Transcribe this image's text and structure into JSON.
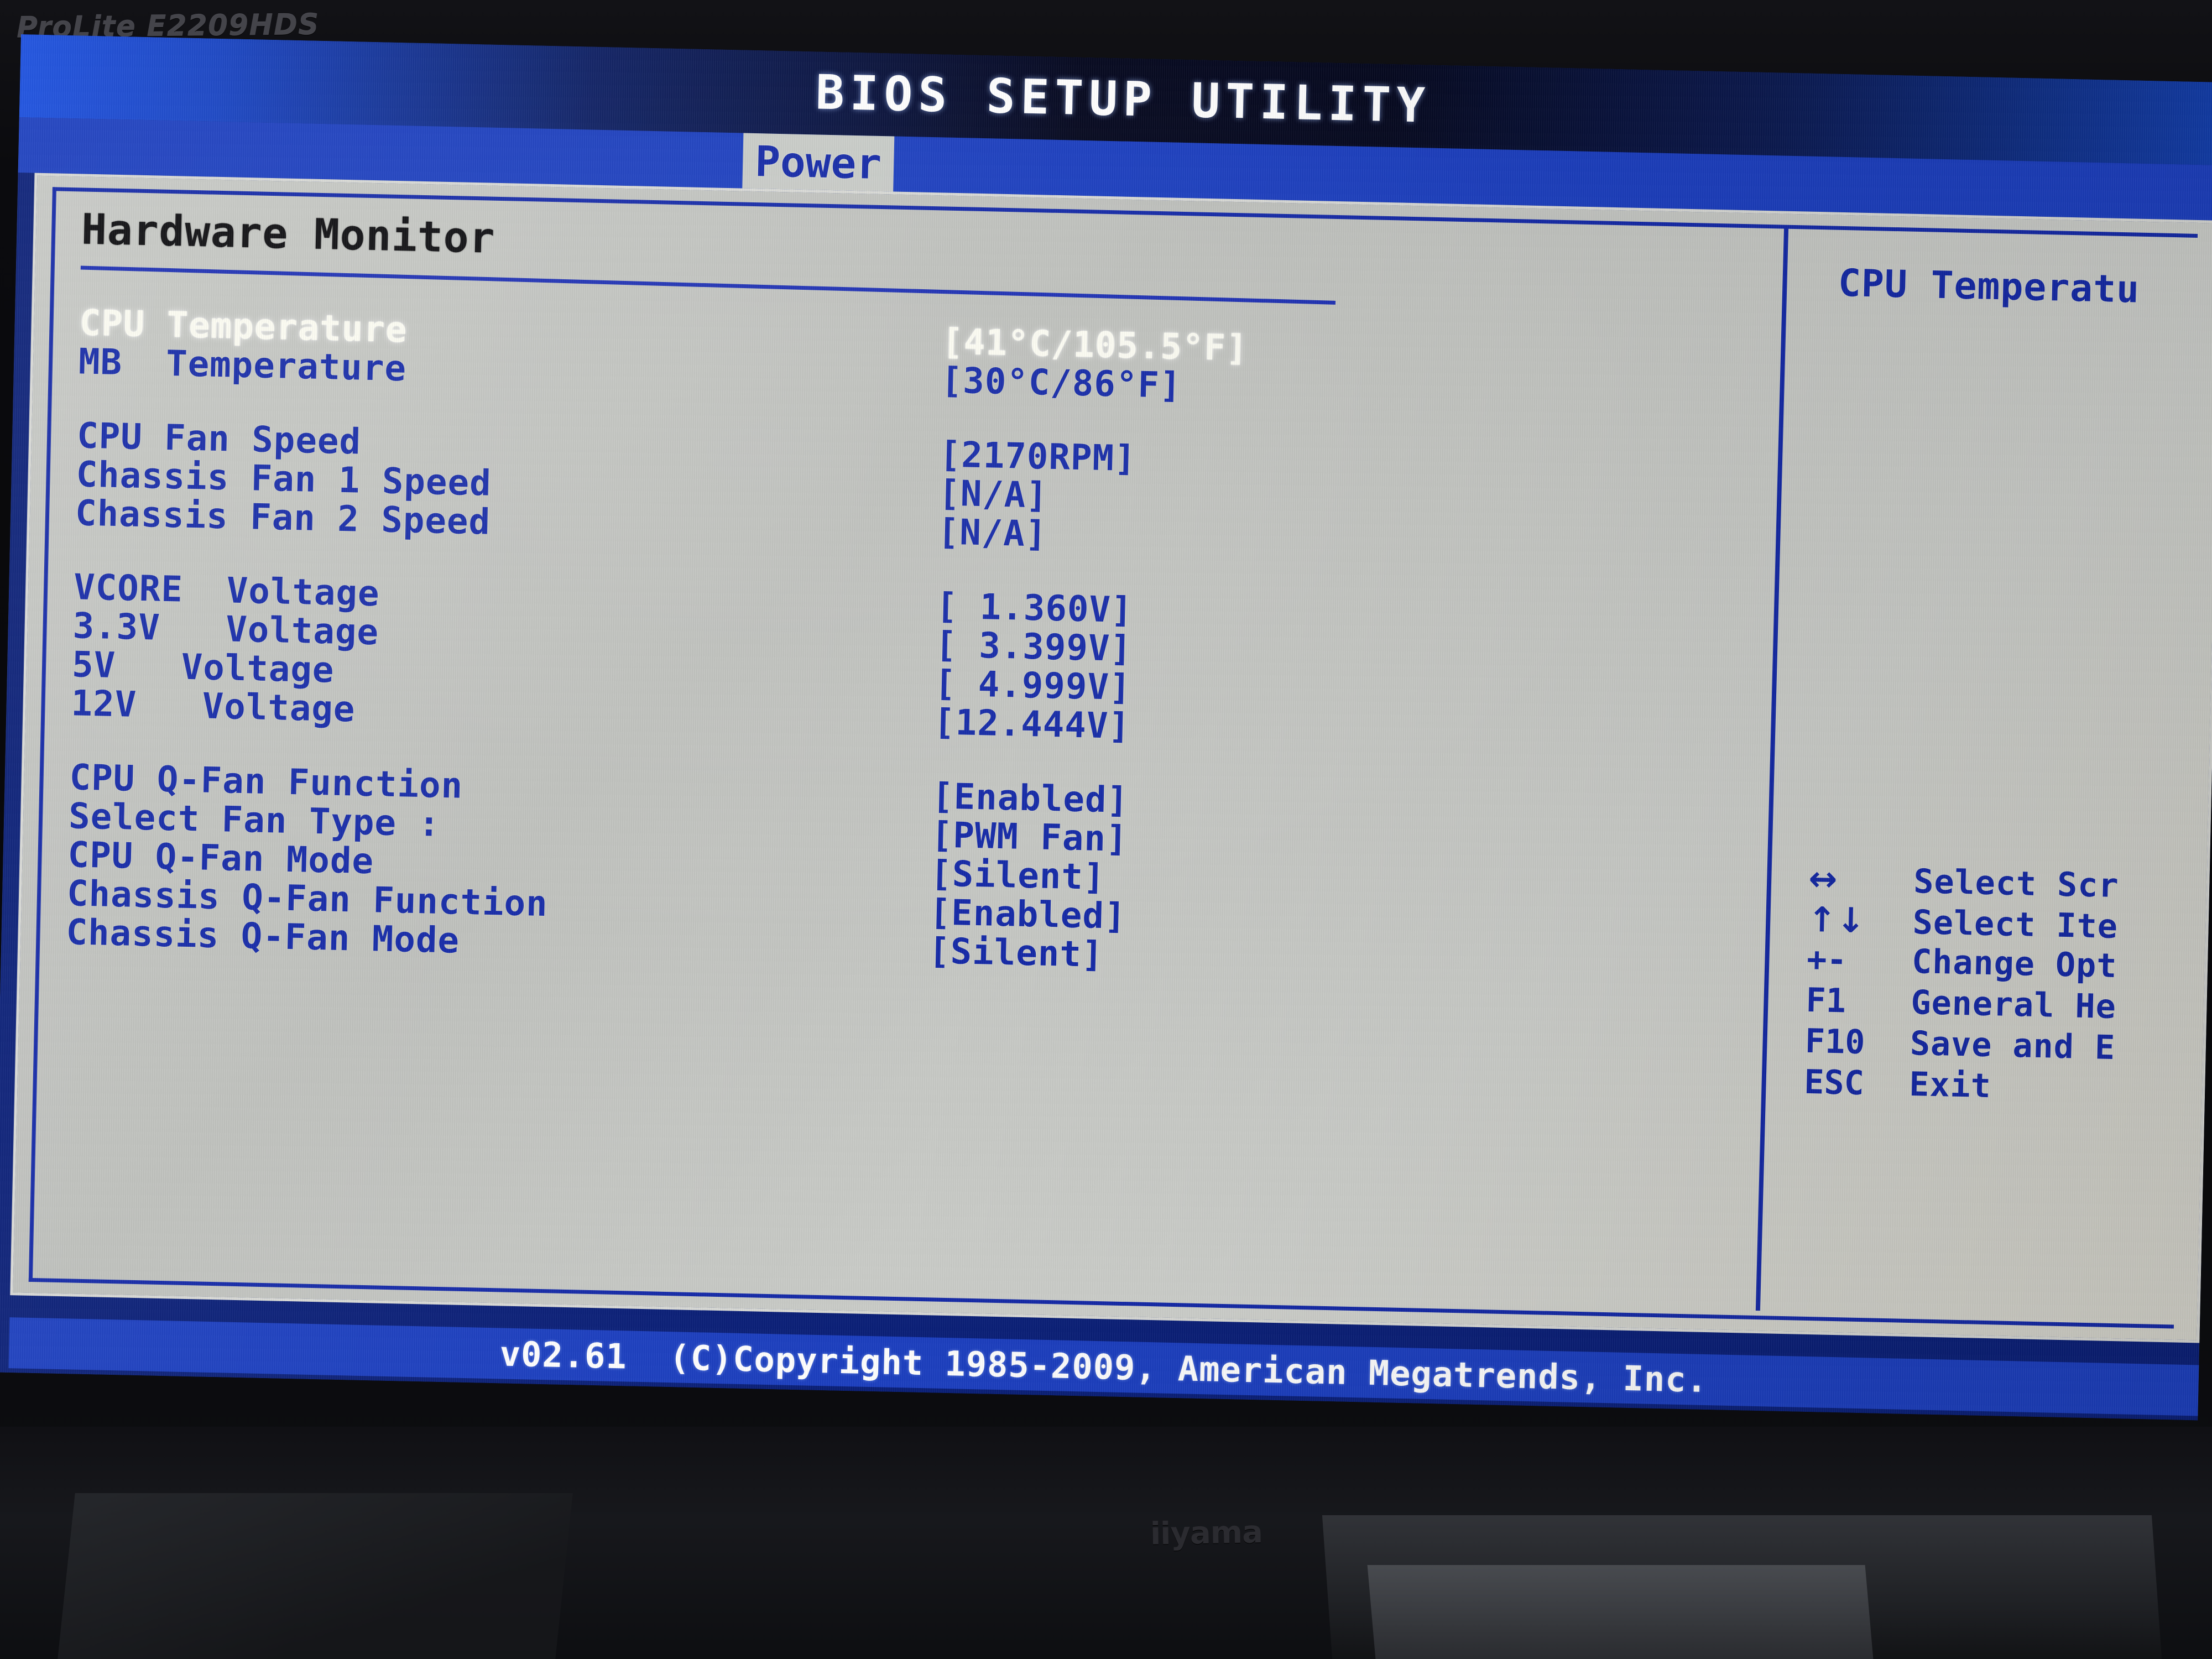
{
  "monitor": {
    "bezel_model": "ProLite E2209HDS",
    "brand_logo": "iiyama"
  },
  "bios": {
    "title": "BIOS SETUP UTILITY",
    "tabs": [
      {
        "label": "Power",
        "selected": true
      }
    ],
    "section_title": "Hardware Monitor",
    "rows": [
      {
        "label": "CPU Temperature",
        "value": "[41°C/105.5°F]",
        "selected": true
      },
      {
        "label": "MB  Temperature",
        "value": "[30°C/86°F]",
        "selected": false
      },
      {
        "spacer": true
      },
      {
        "label": "CPU Fan Speed",
        "value": "[2170RPM]",
        "selected": false
      },
      {
        "label": "Chassis Fan 1 Speed",
        "value": "[N/A]",
        "selected": false
      },
      {
        "label": "Chassis Fan 2 Speed",
        "value": "[N/A]",
        "selected": false
      },
      {
        "spacer": true
      },
      {
        "label": "VCORE  Voltage",
        "value": "[ 1.360V]",
        "selected": false
      },
      {
        "label": "3.3V   Voltage",
        "value": "[ 3.399V]",
        "selected": false
      },
      {
        "label": "5V   Voltage",
        "value": "[ 4.999V]",
        "selected": false
      },
      {
        "label": "12V   Voltage",
        "value": "[12.444V]",
        "selected": false
      },
      {
        "spacer": true
      },
      {
        "label": "CPU Q-Fan Function",
        "value": "[Enabled]",
        "selected": false
      },
      {
        "label": "Select Fan Type :",
        "value": "[PWM Fan]",
        "selected": false
      },
      {
        "label": "CPU Q-Fan Mode",
        "value": "[Silent]",
        "selected": false
      },
      {
        "label": "Chassis Q-Fan Function",
        "value": "[Enabled]",
        "selected": false
      },
      {
        "label": "Chassis Q-Fan Mode",
        "value": "[Silent]",
        "selected": false
      }
    ],
    "help": {
      "title": "CPU Temperatu",
      "keys": [
        {
          "key": "↔",
          "desc": "Select Scr"
        },
        {
          "key": "↑↓",
          "desc": "Select Ite"
        },
        {
          "key": "+-",
          "desc": "Change Opt"
        },
        {
          "key": "F1",
          "desc": "General He"
        },
        {
          "key": "F10",
          "desc": "Save and E"
        },
        {
          "key": "ESC",
          "desc": "Exit"
        }
      ]
    },
    "footer": "v02.61  (C)Copyright 1985-2009, American Megatrends, Inc.",
    "colors": {
      "accent_blue": "#1429a8",
      "title_bar_blue": "#1c3fc0",
      "panel_gray": "#c8cac6",
      "selected_text": "#fdfdf4"
    }
  }
}
